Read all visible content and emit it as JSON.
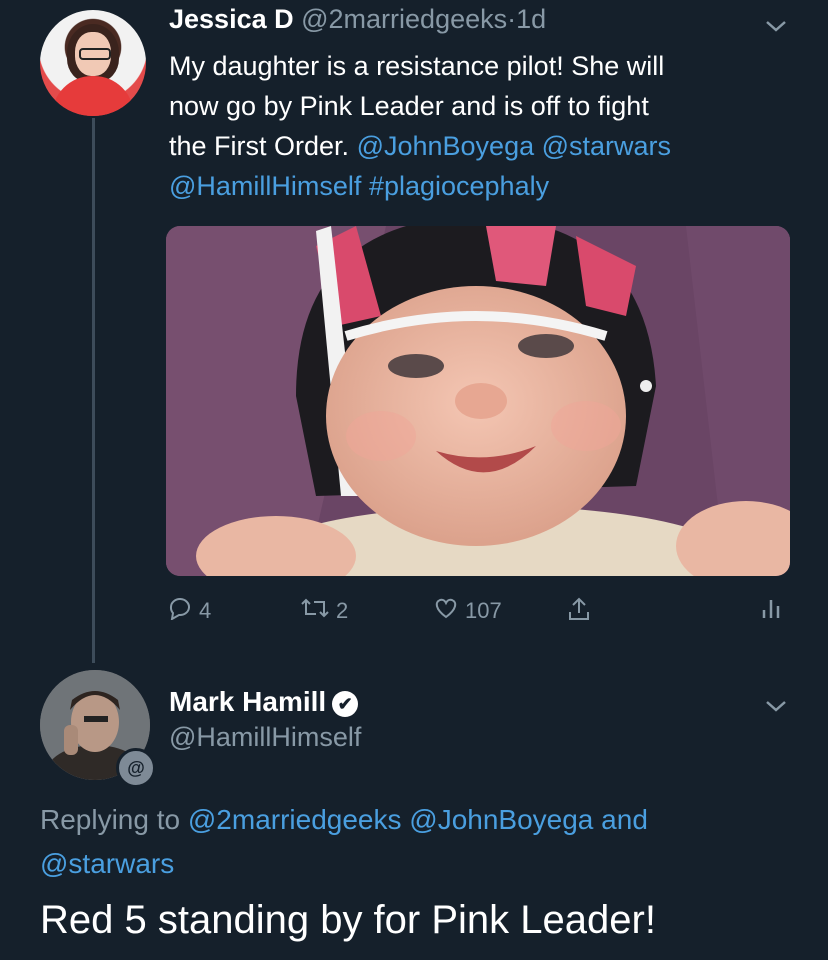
{
  "tweet1": {
    "name": "Jessica D",
    "handle": "@2marriedgeeks",
    "separator": "·",
    "time": "1d",
    "text_line1": "My daughter is a resistance pilot! She will",
    "text_line2": "now go by Pink Leader and is off to fight",
    "text_line3a": "the First Order.",
    "mention_johnboyega": "@JohnBoyega",
    "mention_starwars": "@starwars",
    "mention_hamill": "@HamillHimself",
    "hashtag": "#plagiocephaly",
    "replies_count": "4",
    "retweets_count": "2",
    "likes_count": "107"
  },
  "tweet2": {
    "name": "Mark Hamill",
    "handle": "@HamillHimself",
    "replying_prefix": "Replying to",
    "replying_mentions1": "@2marriedgeeks @JohnBoyega",
    "replying_and": "and",
    "replying_mentions2": "@starwars",
    "text": "Red 5 standing by for Pink Leader!",
    "badge_symbol": "@"
  },
  "colors": {
    "background": "#15202b",
    "link": "#4a9fe0",
    "muted": "#8899a6"
  },
  "icons": [
    "chevron-down-icon",
    "reply-icon",
    "retweet-icon",
    "like-icon",
    "share-icon",
    "analytics-icon",
    "verified-icon"
  ]
}
